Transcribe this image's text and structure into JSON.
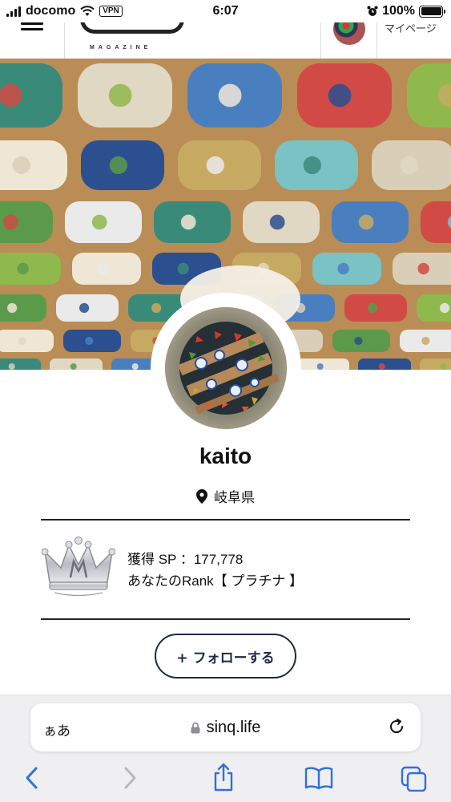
{
  "status_bar": {
    "carrier": "docomo",
    "vpn": "VPN",
    "time": "6:07",
    "battery": "100%"
  },
  "header": {
    "logo_sub": "MAGAZINE",
    "mypage_label": "マイページ"
  },
  "profile": {
    "username": "kaito",
    "location": "岐阜県"
  },
  "rank": {
    "points_line": "獲得 SP ：177,778",
    "rank_line": "あなたのRank【 プラチナ 】"
  },
  "follow_button": {
    "label": "+ フォローする"
  },
  "browser": {
    "aa_label": "ぁあ",
    "url": "sinq.life"
  },
  "colors": {
    "accent": "#1c2a44",
    "browser_bar": "#efeff1",
    "ceiling_wood": "#c79c62"
  },
  "icons": {
    "location": "map-pin-icon",
    "lock": "lock-icon",
    "reload": "reload-icon",
    "back": "chevron-left-icon",
    "forward": "chevron-right-icon",
    "share": "share-icon",
    "bookmarks": "book-icon",
    "tabs": "tabs-icon"
  }
}
